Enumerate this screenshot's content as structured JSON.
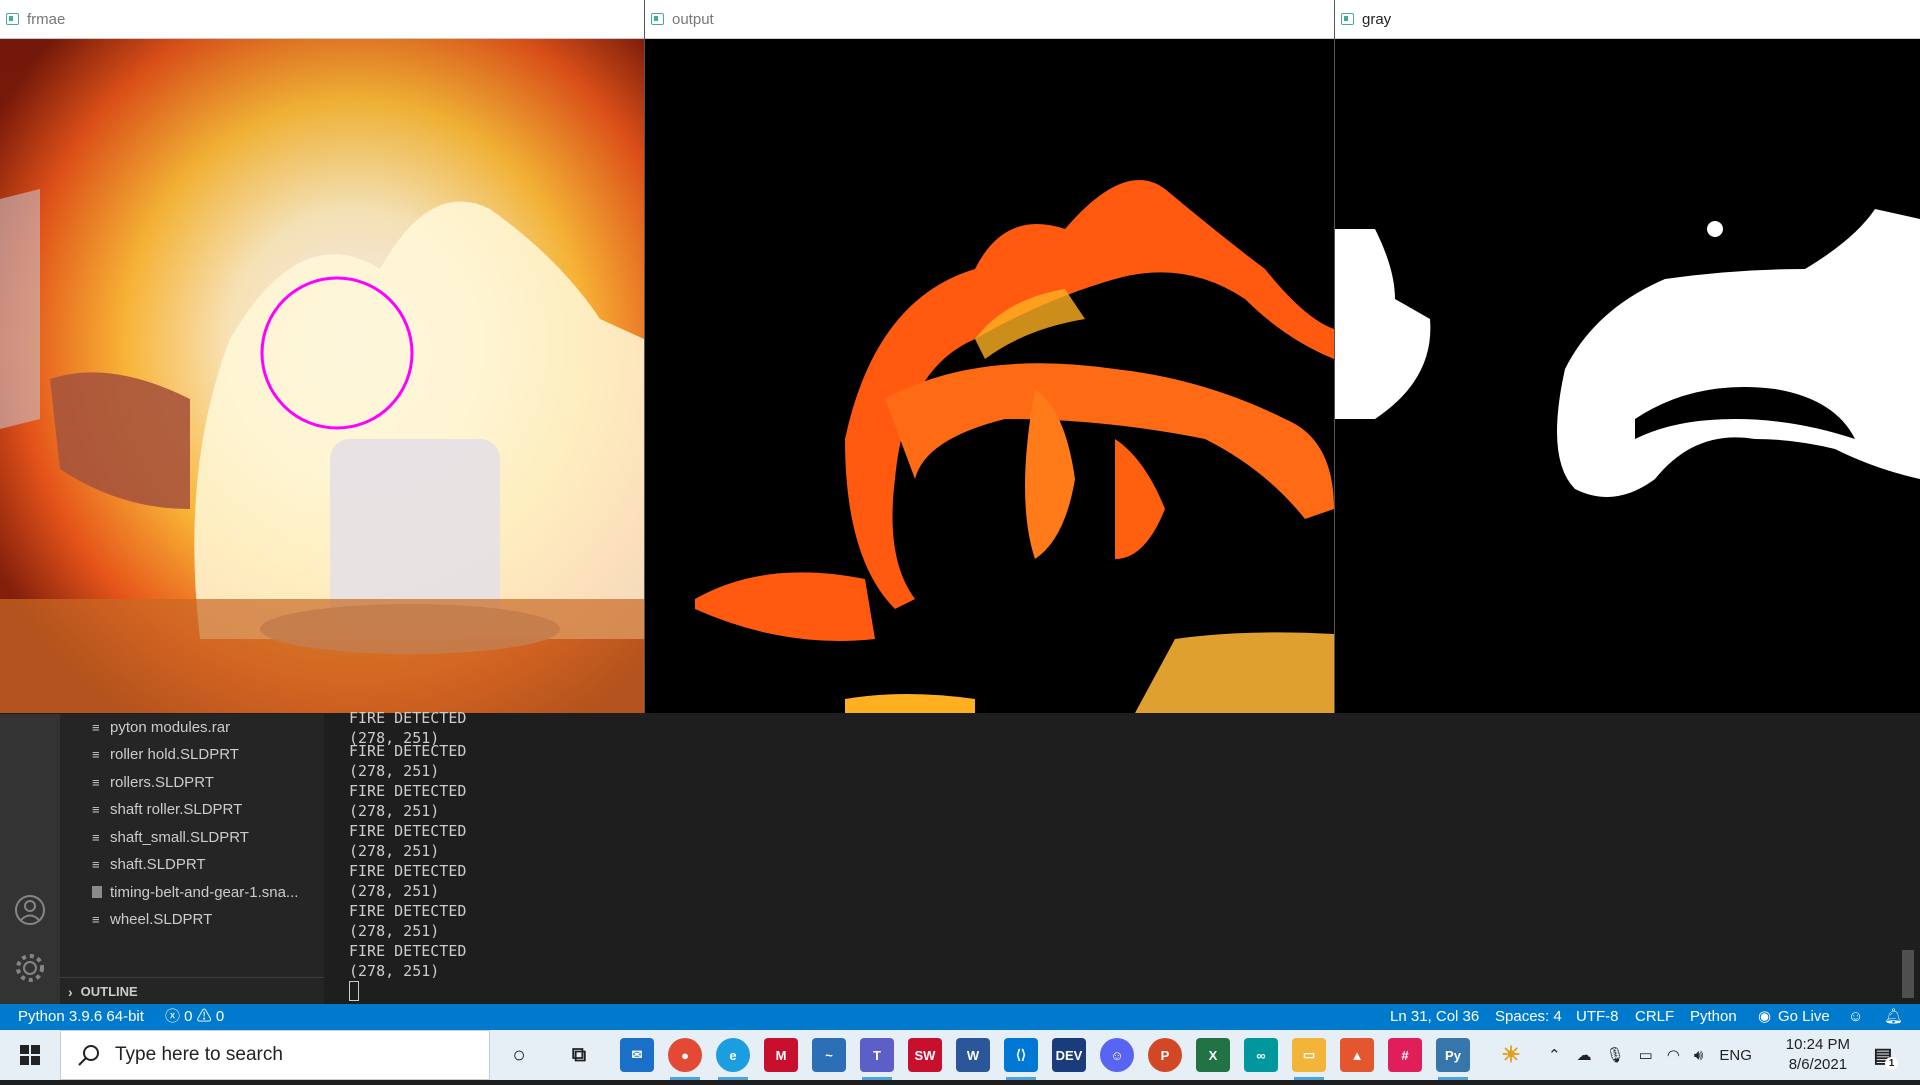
{
  "windows": {
    "frame": {
      "title": "frmae"
    },
    "output": {
      "title": "output"
    },
    "gray": {
      "title": "gray"
    }
  },
  "explorer": {
    "files": [
      {
        "name": "pyton modules.rar",
        "icon": "file-lines-icon"
      },
      {
        "name": "roller hold.SLDPRT",
        "icon": "file-lines-icon"
      },
      {
        "name": "rollers.SLDPRT",
        "icon": "file-lines-icon"
      },
      {
        "name": "shaft roller.SLDPRT",
        "icon": "file-lines-icon"
      },
      {
        "name": "shaft_small.SLDPRT",
        "icon": "file-lines-icon"
      },
      {
        "name": "shaft.SLDPRT",
        "icon": "file-lines-icon"
      },
      {
        "name": "timing-belt-and-gear-1.sna...",
        "icon": "image-file-icon"
      },
      {
        "name": "wheel.SLDPRT",
        "icon": "file-lines-icon"
      }
    ],
    "outline_label": "OUTLINE"
  },
  "terminal": {
    "lines": [
      "FIRE DETECTED",
      "(278, 251)",
      "FIRE DETECTED",
      "(278, 251)",
      "FIRE DETECTED",
      "(278, 251)",
      "FIRE DETECTED",
      "(278, 251)",
      "FIRE DETECTED",
      "(278, 251)",
      "FIRE DETECTED",
      "(278, 251)",
      "FIRE DETECTED",
      "(278, 251)"
    ]
  },
  "statusbar": {
    "interpreter": "Python 3.9.6 64-bit",
    "problems": "ⓧ 0 ⚠ 0",
    "position": "Ln 31, Col 36",
    "spaces": "Spaces: 4",
    "encoding": "UTF-8",
    "eol": "CRLF",
    "language": "Python",
    "golive": "Go Live"
  },
  "taskbar": {
    "search_placeholder": "Type here to search",
    "language": "ENG",
    "time": "10:24 PM",
    "date": "8/6/2021",
    "notification_count": "1"
  },
  "colors": {
    "statusbar": "#007acc",
    "detect_circle": "#ff00ff"
  }
}
